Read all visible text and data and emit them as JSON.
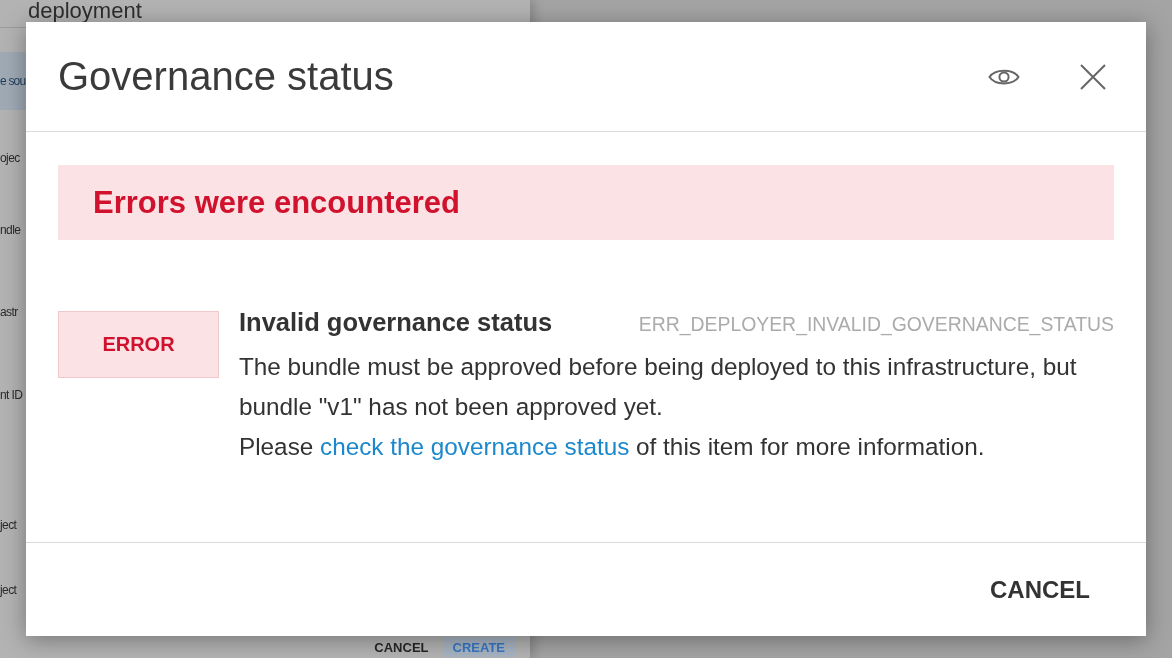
{
  "background_dialog": {
    "title": "deployment",
    "source_button": "e sou",
    "field_labels": [
      "ojec",
      "ndle",
      "astr",
      "nt ID",
      "ject",
      "ject"
    ],
    "buttons": [
      {
        "label": "CANCEL",
        "kind": "text"
      },
      {
        "label": "CREATE",
        "kind": "primary"
      }
    ]
  },
  "dialog": {
    "title": "Governance status",
    "alert": {
      "kind": "error",
      "text": "Errors were encountered"
    },
    "messages": [
      {
        "kind": "error",
        "badge": "ERROR",
        "title": "Invalid governance status",
        "code": "ERR_DEPLOYER_INVALID_GOVERNANCE_STATUS",
        "description": "The bundle must be approved before being deployed to this infrastructure, but bundle \"v1\" has not been approved yet.",
        "help": {
          "before": "Please",
          "link": "check the governance status",
          "after": "of this item for more information."
        }
      }
    ],
    "buttons": [
      "CANCEL"
    ]
  }
}
